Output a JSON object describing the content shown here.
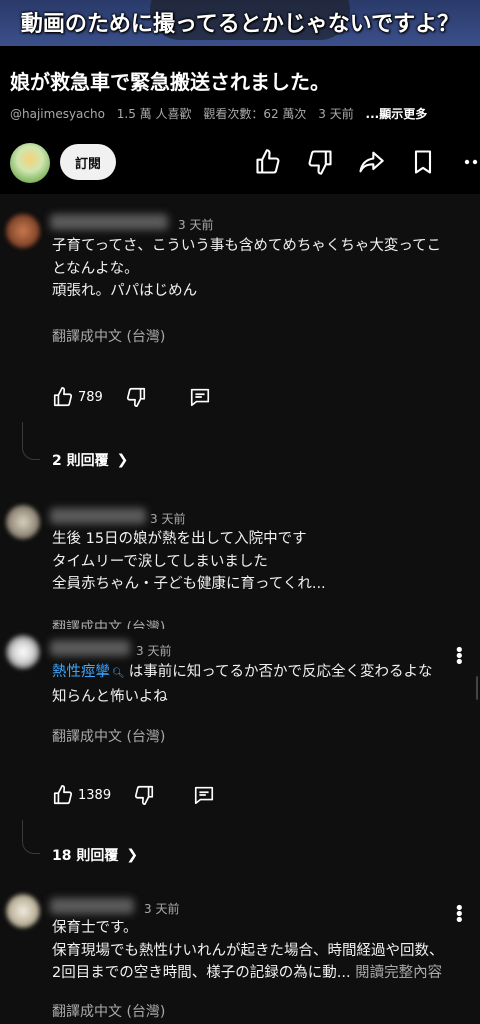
{
  "video": {
    "caption": "動画のために撮ってるとかじゃないですよ？",
    "title": "娘が救急車で緊急搬送されました。",
    "handle": "@hajimesyacho",
    "likes": "1.5 萬 人喜歡",
    "views": "觀看次數：62 萬次",
    "age": "3 天前",
    "more": "...顯示更多",
    "subscribe_label": "訂閱"
  },
  "icons": {
    "like": "thumbs-up-icon",
    "dislike": "thumbs-down-icon",
    "share": "share-icon",
    "save": "bookmark-icon",
    "more": "more-icon",
    "reply": "comment-icon"
  },
  "colors": {
    "background": "#0f0f0f",
    "link": "#3ea6ff",
    "secondary_text": "#aaaaaa"
  },
  "comments": [
    {
      "time": "3 天前",
      "lines": [
        "子育てってさ、こういう事も含めてめちゃくちゃ大変ってこ",
        "となんよな。",
        "頑張れ。パパはじめん"
      ],
      "translate": "翻譯成中文 (台灣)",
      "likes": "789",
      "replies": "2 則回覆"
    },
    {
      "time": "3 天前",
      "lines": [
        "生後 15日の娘が熱を出して入院中です",
        "タイムリーで涙してしまいました",
        "全員赤ちゃん・子ども健康に育ってくれ..."
      ],
      "translate": "翻譯成中文 (台灣)"
    },
    {
      "time": "3 天前",
      "tag": "熱性痙攣",
      "tag_suffix": "は事前に知ってるか否かで反応全く変わるよな",
      "lines": [
        "知らんと怖いよね"
      ],
      "translate": "翻譯成中文 (台灣)",
      "likes": "1389",
      "replies": "18 則回覆"
    },
    {
      "time": "3 天前",
      "lines": [
        "保育士です。",
        "保育現場でも熱性けいれんが起きた場合、時間経過や回数、",
        "2回目までの空き時間、様子の記録の為に動..."
      ],
      "read_more": "閱讀完整內容",
      "translate": "翻譯成中文 (台灣)"
    }
  ]
}
